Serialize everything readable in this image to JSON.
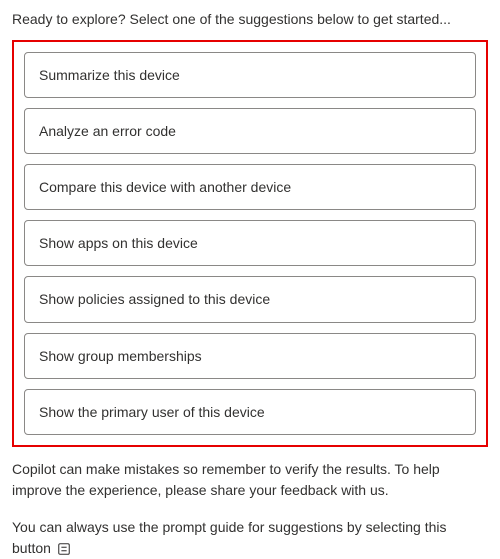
{
  "intro": "Ready to explore? Select one of the suggestions below to get started...",
  "suggestions": [
    {
      "label": "Summarize this device"
    },
    {
      "label": "Analyze an error code"
    },
    {
      "label": "Compare this device with another device"
    },
    {
      "label": "Show apps on this device"
    },
    {
      "label": "Show policies assigned to this device"
    },
    {
      "label": "Show group memberships"
    },
    {
      "label": "Show the primary user of this device"
    }
  ],
  "disclaimer": "Copilot can make mistakes so remember to verify the results. To help improve the experience, please share your feedback with us.",
  "prompt_guide_text": "You can always use the prompt guide for suggestions by selecting this button",
  "icons": {
    "prompt_guide": "prompt-guide-icon"
  }
}
